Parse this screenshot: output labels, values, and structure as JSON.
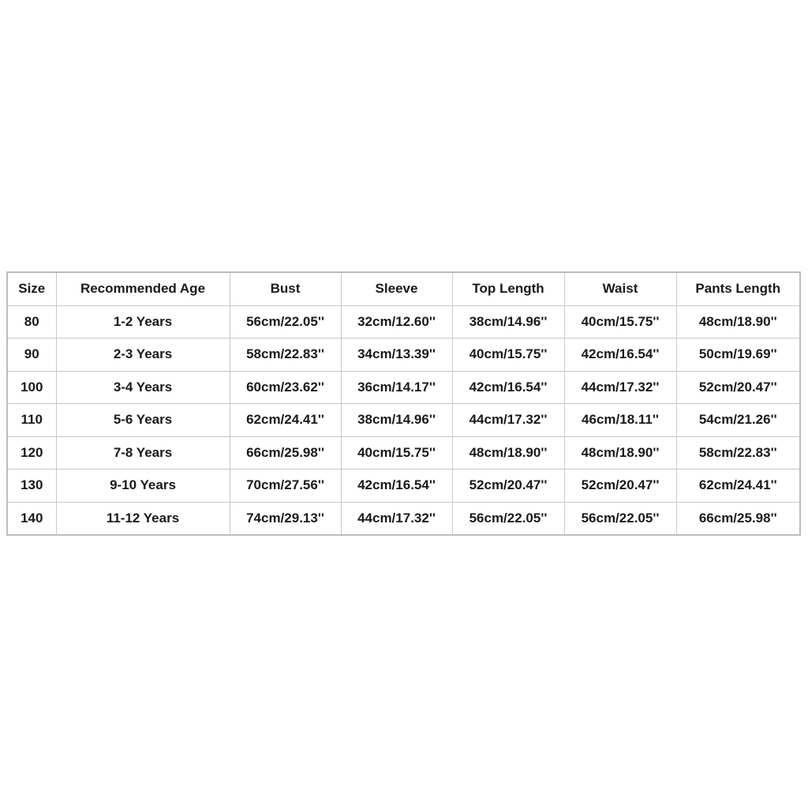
{
  "table": {
    "headers": [
      "Size",
      "Recommended Age",
      "Bust",
      "Sleeve",
      "Top Length",
      "Waist",
      "Pants Length"
    ],
    "rows": [
      [
        "80",
        "1-2 Years",
        "56cm/22.05''",
        "32cm/12.60''",
        "38cm/14.96''",
        "40cm/15.75''",
        "48cm/18.90''"
      ],
      [
        "90",
        "2-3 Years",
        "58cm/22.83''",
        "34cm/13.39''",
        "40cm/15.75''",
        "42cm/16.54''",
        "50cm/19.69''"
      ],
      [
        "100",
        "3-4 Years",
        "60cm/23.62''",
        "36cm/14.17''",
        "42cm/16.54''",
        "44cm/17.32''",
        "52cm/20.47''"
      ],
      [
        "110",
        "5-6 Years",
        "62cm/24.41''",
        "38cm/14.96''",
        "44cm/17.32''",
        "46cm/18.11''",
        "54cm/21.26''"
      ],
      [
        "120",
        "7-8 Years",
        "66cm/25.98''",
        "40cm/15.75''",
        "48cm/18.90''",
        "48cm/18.90''",
        "58cm/22.83''"
      ],
      [
        "130",
        "9-10 Years",
        "70cm/27.56''",
        "42cm/16.54''",
        "52cm/20.47''",
        "52cm/20.47''",
        "62cm/24.41''"
      ],
      [
        "140",
        "11-12 Years",
        "74cm/29.13''",
        "44cm/17.32''",
        "56cm/22.05''",
        "56cm/22.05''",
        "66cm/25.98''"
      ]
    ]
  }
}
